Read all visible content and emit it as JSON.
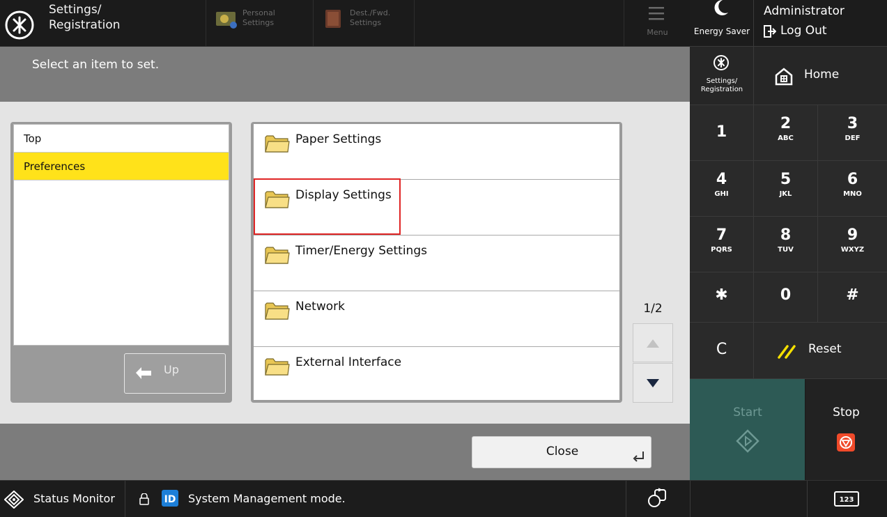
{
  "header": {
    "title": "Settings/\nRegistration",
    "nav": [
      {
        "label": "Personal\nSettings"
      },
      {
        "label": "Dest./Fwd.\nSettings"
      }
    ],
    "menu_label": "Menu"
  },
  "main": {
    "prompt": "Select an item to set.",
    "tree": [
      {
        "label": "Top",
        "selected": false
      },
      {
        "label": "Preferences",
        "selected": true
      }
    ],
    "up_label": "Up",
    "items": [
      {
        "label": "Paper Settings"
      },
      {
        "label": "Display Settings"
      },
      {
        "label": "Timer/Energy Settings"
      },
      {
        "label": "Network"
      },
      {
        "label": "External Interface"
      }
    ],
    "page_indicator": "1/2",
    "close_label": "Close"
  },
  "side": {
    "energy_saver_label": "Energy Saver",
    "admin_name": "Administrator",
    "logout_label": "Log Out",
    "settings_label": "Settings/\nRegistration",
    "home_label": "Home",
    "keys": [
      {
        "main": "1",
        "sub": ""
      },
      {
        "main": "2",
        "sub": "ABC"
      },
      {
        "main": "3",
        "sub": "DEF"
      },
      {
        "main": "4",
        "sub": "GHI"
      },
      {
        "main": "5",
        "sub": "JKL"
      },
      {
        "main": "6",
        "sub": "MNO"
      },
      {
        "main": "7",
        "sub": "PQRS"
      },
      {
        "main": "8",
        "sub": "TUV"
      },
      {
        "main": "9",
        "sub": "WXYZ"
      },
      {
        "main": "✱",
        "sub": ""
      },
      {
        "main": "0",
        "sub": ""
      },
      {
        "main": "#",
        "sub": ""
      },
      {
        "main": "C",
        "sub": ""
      }
    ],
    "reset_label": "Reset",
    "start_label": "Start",
    "stop_label": "Stop"
  },
  "status": {
    "monitor_label": "Status Monitor",
    "mode_text": "System Management mode.",
    "id_badge": "ID",
    "keyboard_badge": "123"
  },
  "colors": {
    "highlight": "#ffe21a",
    "selection_border": "#e02424",
    "start": "#2d5a55",
    "stop_icon": "#f04a2a",
    "folder": "#f5d76e"
  }
}
